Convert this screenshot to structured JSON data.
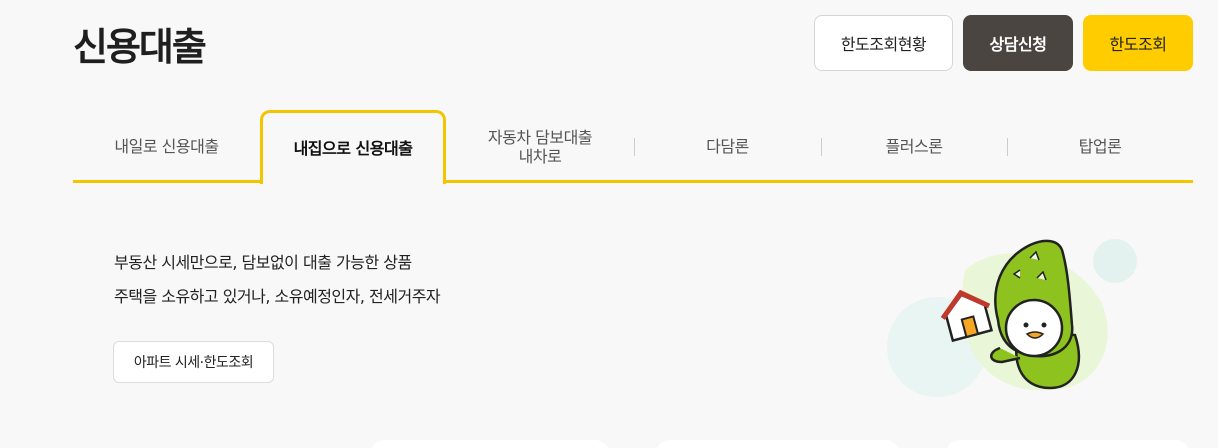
{
  "header": {
    "title": "신용대출",
    "buttons": {
      "status": "한도조회현황",
      "consult": "상담신청",
      "limit": "한도조회"
    }
  },
  "tabs": [
    {
      "label": "내일로 신용대출",
      "active": false
    },
    {
      "label": "내집으로 신용대출",
      "active": true
    },
    {
      "label_line1": "자동차 담보대출",
      "label_line2": "내차로",
      "active": false
    },
    {
      "label": "다담론",
      "active": false
    },
    {
      "label": "플러스론",
      "active": false
    },
    {
      "label": "탑업론",
      "active": false
    }
  ],
  "content": {
    "line1": "부동산 시세만으로, 담보없이 대출 가능한 상품",
    "line2": "주택을 소유하고 있거나, 소유예정인자, 전세거주자",
    "price_button": "아파트 시세·한도조회"
  },
  "colors": {
    "accent": "#f5c400",
    "limit_button": "#ffcc00",
    "consult_button": "#4a4540",
    "background": "#f8f8f8"
  },
  "icons": {
    "illustration": "crocodile-mascot-with-house"
  }
}
